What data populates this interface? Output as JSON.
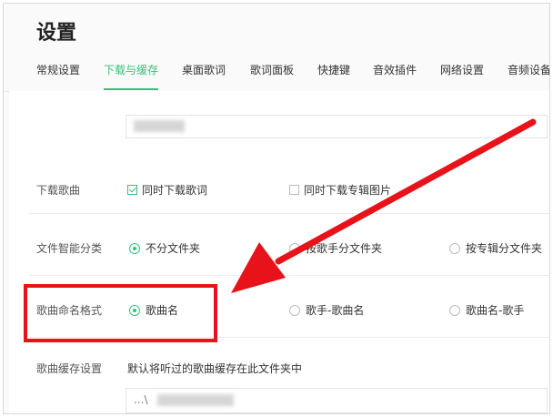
{
  "header": {
    "title": "设置"
  },
  "tabs": [
    {
      "label": "常规设置",
      "active": false
    },
    {
      "label": "下载与缓存",
      "active": true
    },
    {
      "label": "桌面歌词",
      "active": false
    },
    {
      "label": "歌词面板",
      "active": false
    },
    {
      "label": "快捷键",
      "active": false
    },
    {
      "label": "音效插件",
      "active": false
    },
    {
      "label": "网络设置",
      "active": false
    },
    {
      "label": "音频设备",
      "active": false
    }
  ],
  "download_songs": {
    "label": "下载歌曲",
    "options": [
      {
        "label": "同时下载歌词",
        "checked": true
      },
      {
        "label": "同时下载专辑图片",
        "checked": false
      }
    ]
  },
  "smart_category": {
    "label": "文件智能分类",
    "options": [
      {
        "label": "不分文件夹",
        "selected": true
      },
      {
        "label": "按歌手分文件夹",
        "selected": false
      },
      {
        "label": "按专辑分文件夹",
        "selected": false
      }
    ]
  },
  "naming_format": {
    "label": "歌曲命名格式",
    "options": [
      {
        "label": "歌曲名",
        "selected": true
      },
      {
        "label": "歌手-歌曲名",
        "selected": false
      },
      {
        "label": "歌曲名-歌手",
        "selected": false
      }
    ]
  },
  "cache": {
    "label": "歌曲缓存设置",
    "description": "默认将听过的歌曲缓存在此文件夹中",
    "path_value": "...\\"
  },
  "colors": {
    "accent": "#31c27c",
    "annotation_red": "#e8121a"
  }
}
